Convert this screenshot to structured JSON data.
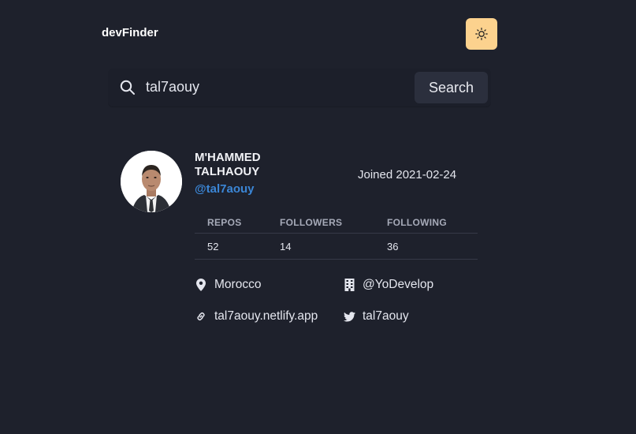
{
  "header": {
    "logo": "devFinder",
    "theme_icon": "sun-icon"
  },
  "search": {
    "value": "tal7aouy",
    "placeholder": "",
    "button_label": "Search",
    "icon": "search-icon"
  },
  "profile": {
    "name": "M'HAMMED TALHAOUY",
    "login": "@tal7aouy",
    "joined": "Joined 2021-02-24",
    "stats": {
      "repos_label": "REPOS",
      "followers_label": "FOLLOWERS",
      "following_label": "FOLLOWING",
      "repos": "52",
      "followers": "14",
      "following": "36"
    },
    "info": {
      "location": "Morocco",
      "company": "@YoDevelop",
      "website": "tal7aouy.netlify.app",
      "twitter": "tal7aouy"
    }
  },
  "colors": {
    "background": "#1e212c",
    "accent_link": "#3b86d6",
    "toggle_bg": "#fcd28e"
  }
}
